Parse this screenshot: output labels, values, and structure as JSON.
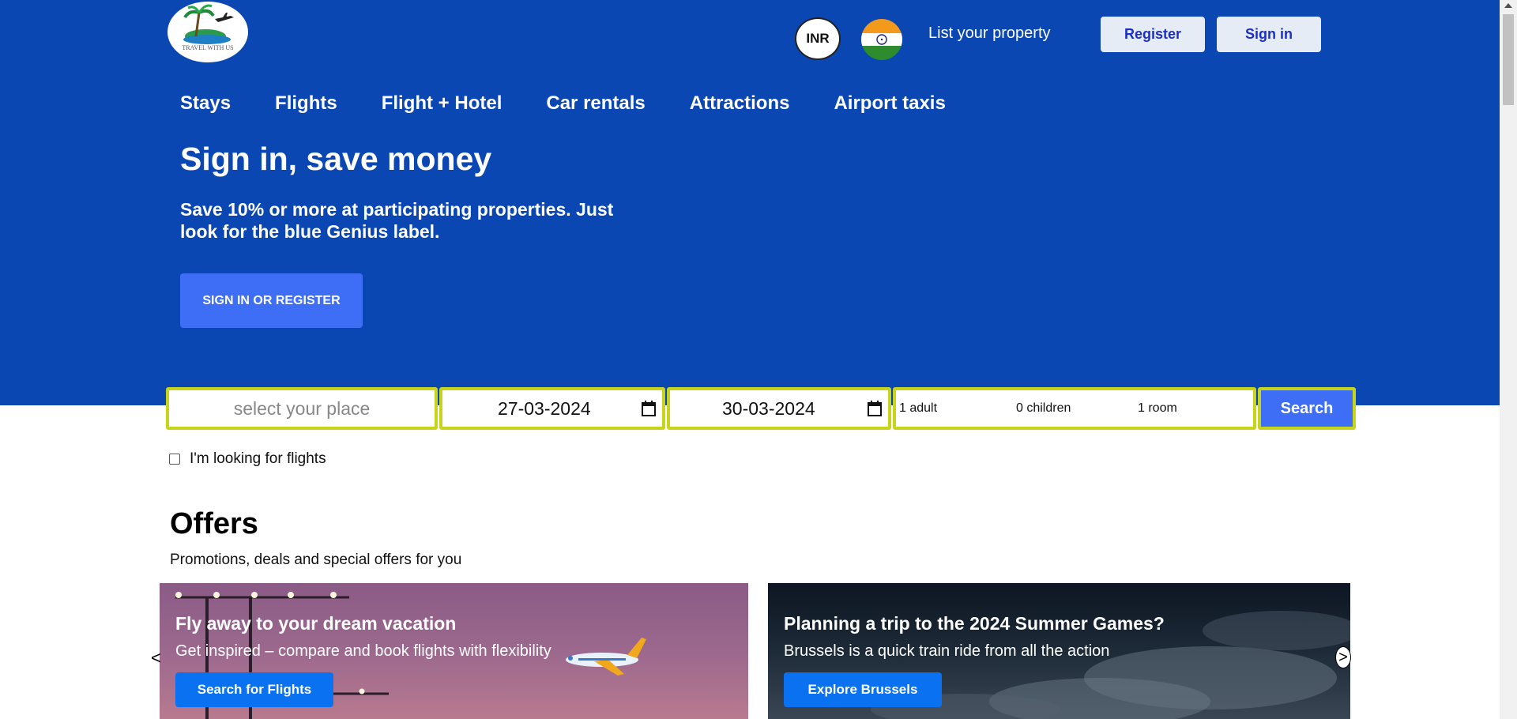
{
  "header": {
    "logo_text": "TRAVEL WITH US",
    "currency": "INR",
    "flag_icon": "india-flag-icon",
    "list_property": "List your property",
    "register_label": "Register",
    "signin_label": "Sign in"
  },
  "nav": {
    "items": [
      "Stays",
      "Flights",
      "Flight + Hotel",
      "Car rentals",
      "Attractions",
      "Airport taxis"
    ]
  },
  "hero": {
    "title": "Sign in, save money",
    "subtitle": "Save 10% or more at participating properties. Just look for the blue Genius label.",
    "cta_label": "SIGN IN OR REGISTER"
  },
  "search": {
    "place_placeholder": "select your place",
    "checkin": "27-03-2024",
    "checkout": "30-03-2024",
    "adults": "1 adult",
    "children": "0 children",
    "rooms": "1 room",
    "button_label": "Search",
    "flights_checkbox_label": "I'm looking for flights",
    "flights_checked": false
  },
  "offers": {
    "title": "Offers",
    "subtitle": "Promotions, deals and special offers for you",
    "cards": [
      {
        "title": "Fly away to your dream vacation",
        "subtitle": "Get inspired – compare and book flights with flexibility",
        "button": "Search for Flights"
      },
      {
        "title": "Planning a trip to the 2024 Summer Games?",
        "subtitle": "Brussels is a quick train ride from all the action",
        "button": "Explore Brussels"
      }
    ],
    "prev_arrow": "<",
    "next_arrow": ">"
  },
  "colors": {
    "hero_bg": "#0b47b3",
    "accent": "#3d6ef5",
    "search_border": "#c6d41c",
    "card_button": "#0a72f0"
  }
}
